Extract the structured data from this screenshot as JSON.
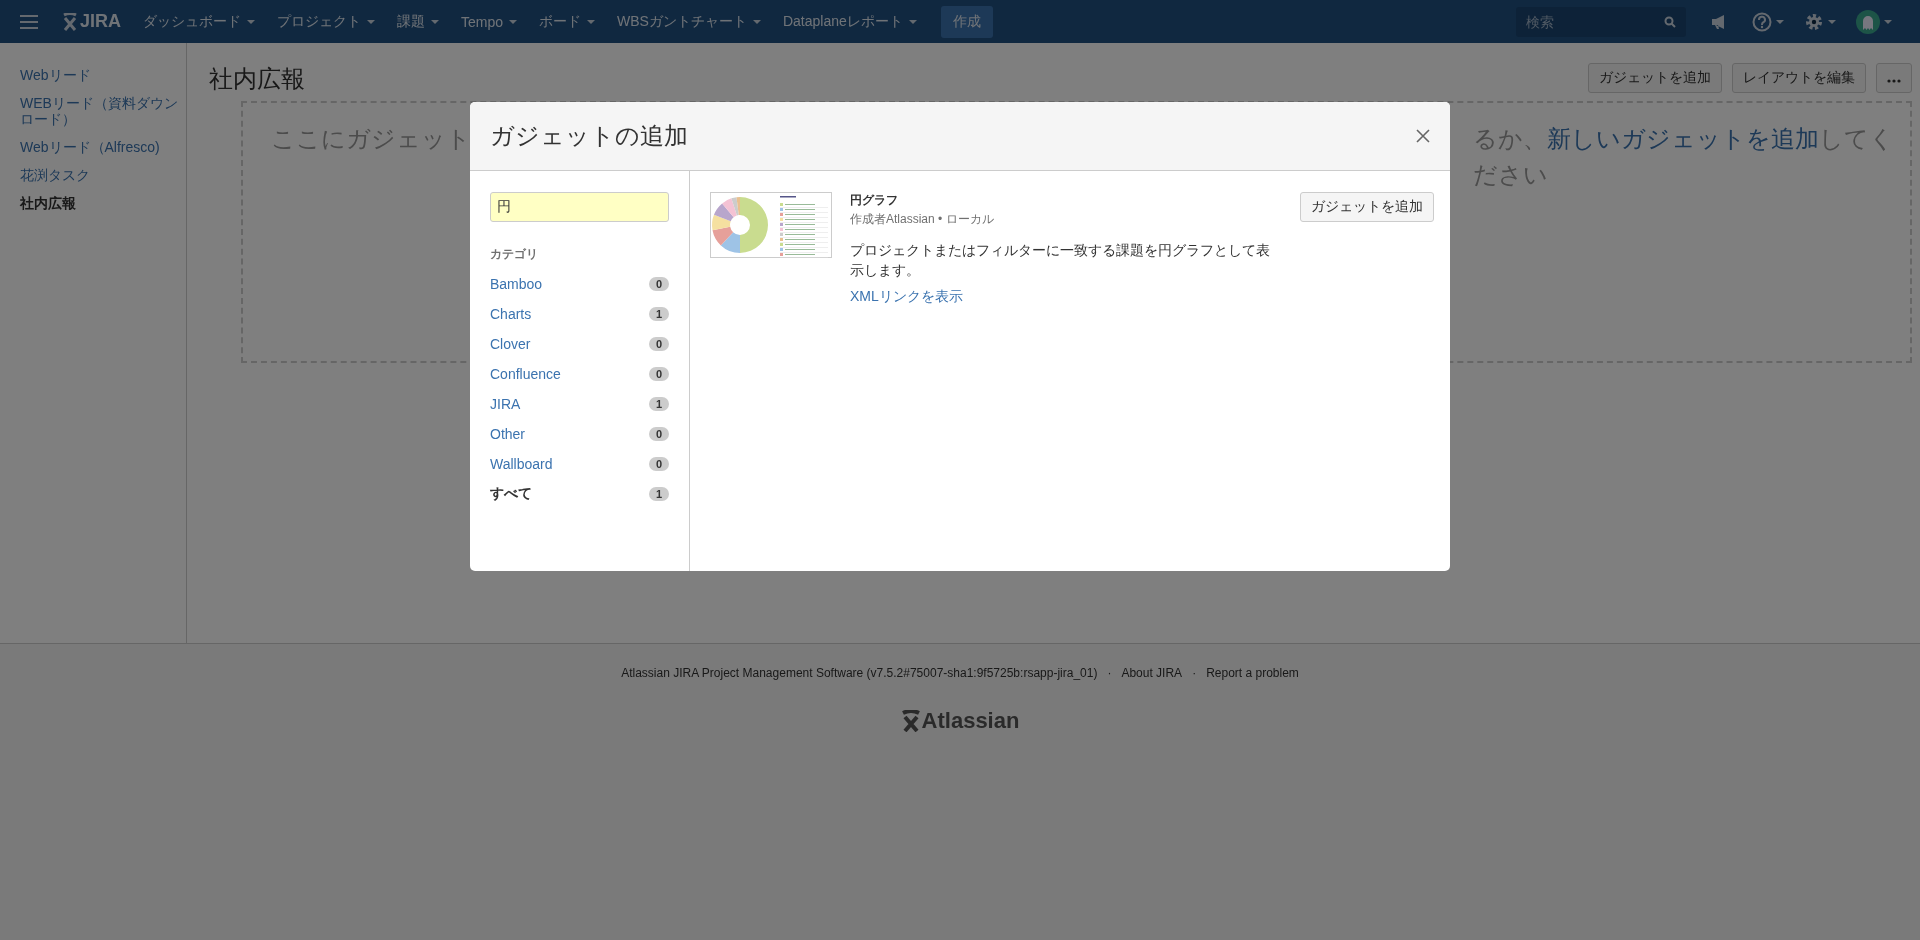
{
  "nav": {
    "logo": "JIRA",
    "items": [
      "ダッシュボード",
      "プロジェクト",
      "課題",
      "Tempo",
      "ボード",
      "WBSガントチャート",
      "Dataplaneレポート"
    ],
    "create": "作成",
    "search": {
      "placeholder": "検索"
    }
  },
  "sidebar": {
    "items": [
      {
        "label": "Webリード",
        "selected": false
      },
      {
        "label": "WEBリード（資料ダウンロード）",
        "selected": false
      },
      {
        "label": "Webリード（Alfresco)",
        "selected": false
      },
      {
        "label": "花渕タスク",
        "selected": false
      },
      {
        "label": "社内広報",
        "selected": true
      }
    ]
  },
  "dashboard": {
    "title": "社内広報",
    "buttons": [
      "ガジェットを追加",
      "レイアウトを編集"
    ],
    "empty_text": {
      "start": "ここにガジェット",
      "middle": "るか、",
      "link": "新しいガジェットを追加",
      "end": "してく",
      "line2": "ださい"
    }
  },
  "dialog": {
    "title": "ガジェットの追加",
    "search": {
      "value": "円"
    },
    "categories_heading": "カテゴリ",
    "categories": [
      {
        "label": "Bamboo",
        "count": "0",
        "selected": false
      },
      {
        "label": "Charts",
        "count": "1",
        "selected": false
      },
      {
        "label": "Clover",
        "count": "0",
        "selected": false
      },
      {
        "label": "Confluence",
        "count": "0",
        "selected": false
      },
      {
        "label": "JIRA",
        "count": "1",
        "selected": false
      },
      {
        "label": "Other",
        "count": "0",
        "selected": false
      },
      {
        "label": "Wallboard",
        "count": "0",
        "selected": false
      },
      {
        "label": "すべて",
        "count": "1",
        "selected": true
      }
    ],
    "gadgets": [
      {
        "title": "円グラフ",
        "author": "作成者Atlassian • ローカル",
        "description": "プロジェクトまたはフィルターに一致する課題を円グラフとして表示します。",
        "xml_link": "XMLリンクを表示",
        "button": "ガジェットを追加"
      }
    ]
  },
  "footer": {
    "version": "Atlassian JIRA Project Management Software (v7.5.2#75007-sha1:9f5725b:rsapp-jira_01)",
    "separator": "·",
    "links": [
      "About JIRA",
      "Report a problem"
    ],
    "logo": "Atlassian"
  }
}
